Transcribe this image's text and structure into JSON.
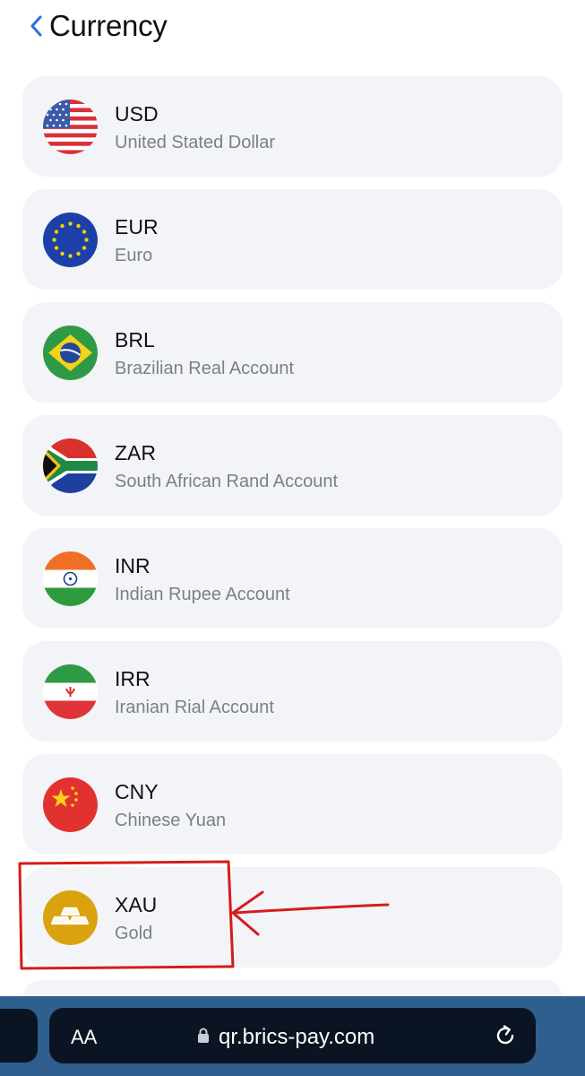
{
  "header": {
    "title": "Currency",
    "back_icon": "chevron-left-icon"
  },
  "currencies": [
    {
      "code": "USD",
      "name": "United Stated Dollar",
      "flag": "us-flag-icon"
    },
    {
      "code": "EUR",
      "name": "Euro",
      "flag": "eu-flag-icon"
    },
    {
      "code": "BRL",
      "name": "Brazilian Real Account",
      "flag": "brazil-flag-icon"
    },
    {
      "code": "ZAR",
      "name": "South African Rand Account",
      "flag": "south-africa-flag-icon"
    },
    {
      "code": "INR",
      "name": "Indian Rupee Account",
      "flag": "india-flag-icon"
    },
    {
      "code": "IRR",
      "name": "Iranian Rial Account",
      "flag": "iran-flag-icon"
    },
    {
      "code": "CNY",
      "name": "Chinese Yuan",
      "flag": "china-flag-icon"
    },
    {
      "code": "XAU",
      "name": "Gold",
      "flag": "gold-bars-icon"
    }
  ],
  "browser": {
    "text_size_button": "AA",
    "url": "qr.brics-pay.com",
    "lock_icon": "lock-icon",
    "reload_icon": "reload-icon"
  },
  "colors": {
    "accent": "#2f6fd6",
    "card_bg": "#f2f4f8",
    "annotation": "#d61b1b",
    "browser_bar": "#2f5f8f",
    "gold": "#d9a20e"
  }
}
